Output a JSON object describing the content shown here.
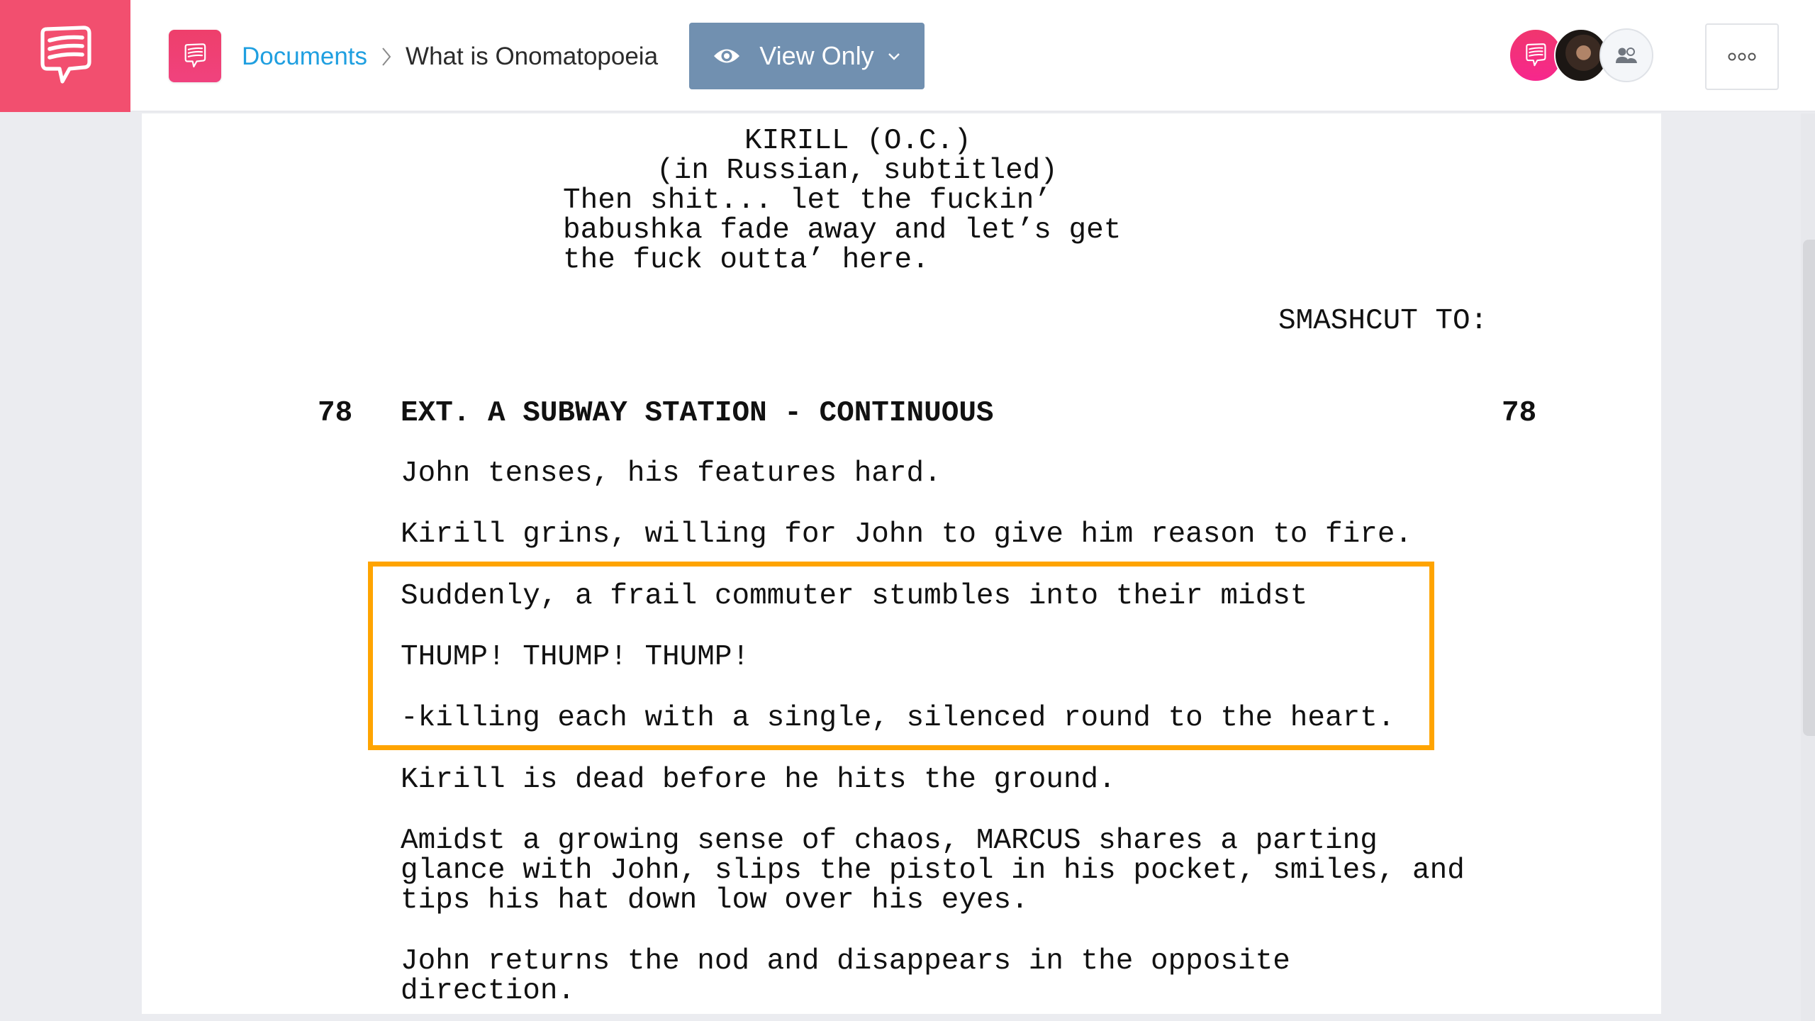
{
  "app": {
    "brand_color": "#f24f6f",
    "highlight_color": "#ffa400",
    "brand_icon": "speech-bubble-icon"
  },
  "header": {
    "breadcrumb": {
      "root_label": "Documents",
      "separator_icon": "chevron-right-icon",
      "current_label": "What is Onomatopoeia"
    },
    "view_mode": {
      "label": "View Only",
      "icon": "eye-icon",
      "dropdown_icon": "chevron-down-icon"
    },
    "collaborators": [
      {
        "type": "brand",
        "icon": "speech-bubble-icon"
      },
      {
        "type": "photo",
        "icon": "user-photo"
      },
      {
        "type": "share",
        "icon": "people-icon"
      }
    ],
    "more_menu_icon": "more-dots-icon"
  },
  "script": {
    "dialogue": {
      "character": "KIRILL (O.C.)",
      "parenthetical": "(in Russian, subtitled)",
      "lines": [
        "Then shit... let the fuckin’",
        "babushka fade away and let’s get",
        "the fuck outta’ here."
      ]
    },
    "transition": "SMASHCUT TO:",
    "scene": {
      "number_left": "78",
      "heading": "EXT. A SUBWAY STATION - CONTINUOUS",
      "number_right": "78"
    },
    "action": [
      {
        "lines": [
          "John tenses, his features hard."
        ]
      },
      {
        "lines": [
          "Kirill grins, willing for John to give him reason to fire."
        ]
      },
      {
        "lines": [
          "Suddenly, a frail commuter stumbles into their midst"
        ],
        "highlighted": true
      },
      {
        "lines": [
          "THUMP! THUMP! THUMP!"
        ],
        "highlighted": true
      },
      {
        "lines": [
          "-killing each with a single, silenced round to the heart."
        ],
        "highlighted": true
      },
      {
        "lines": [
          "Kirill is dead before he hits the ground."
        ]
      },
      {
        "lines": [
          "Amidst a growing sense of chaos, MARCUS shares a parting",
          "glance with John, slips the pistol in his pocket, smiles, and",
          "tips his hat down low over his eyes."
        ]
      },
      {
        "lines": [
          "John returns the nod and disappears in the opposite",
          "direction."
        ]
      }
    ]
  }
}
